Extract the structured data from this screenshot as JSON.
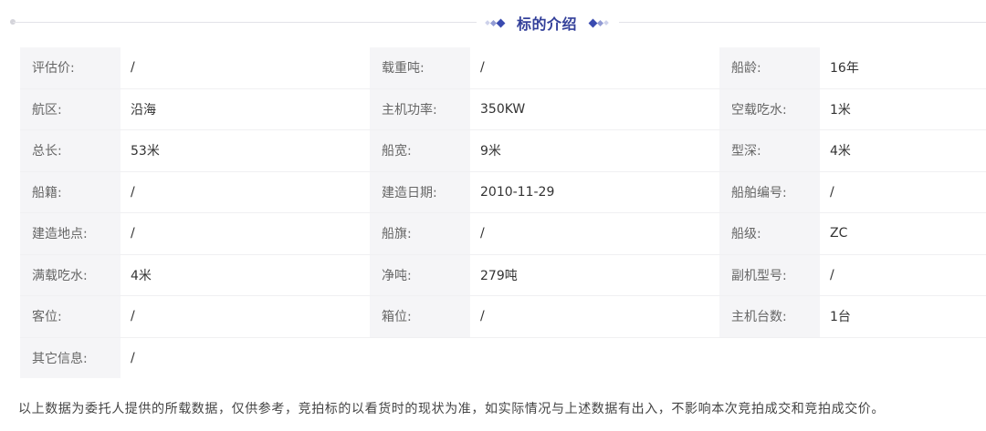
{
  "section": {
    "title": "标的介绍"
  },
  "rows": [
    [
      {
        "label": "评估价:",
        "value": "/"
      },
      {
        "label": "载重吨:",
        "value": "/"
      },
      {
        "label": "船龄:",
        "value": "16年"
      }
    ],
    [
      {
        "label": "航区:",
        "value": "沿海"
      },
      {
        "label": "主机功率:",
        "value": "350KW"
      },
      {
        "label": "空载吃水:",
        "value": "1米"
      }
    ],
    [
      {
        "label": "总长:",
        "value": "53米"
      },
      {
        "label": "船宽:",
        "value": "9米"
      },
      {
        "label": "型深:",
        "value": "4米"
      }
    ],
    [
      {
        "label": "船籍:",
        "value": "/"
      },
      {
        "label": "建造日期:",
        "value": "2010-11-29"
      },
      {
        "label": "船舶编号:",
        "value": "/"
      }
    ],
    [
      {
        "label": "建造地点:",
        "value": "/"
      },
      {
        "label": "船旗:",
        "value": "/"
      },
      {
        "label": "船级:",
        "value": "ZC"
      }
    ],
    [
      {
        "label": "满载吃水:",
        "value": "4米"
      },
      {
        "label": "净吨:",
        "value": "279吨"
      },
      {
        "label": "副机型号:",
        "value": "/"
      }
    ],
    [
      {
        "label": "客位:",
        "value": "/"
      },
      {
        "label": "箱位:",
        "value": "/"
      },
      {
        "label": "主机台数:",
        "value": "1台"
      }
    ],
    [
      {
        "label": "其它信息:",
        "value": "/"
      }
    ]
  ],
  "disclaimer": "以上数据为委托人提供的所载数据，仅供参考，竞拍标的以看货时的现状为准，如实际情况与上述数据有出入，不影响本次竞拍成交和竞拍成交价。",
  "colors": {
    "accent": "#33409a",
    "label_bg": "#f5f5f7"
  }
}
